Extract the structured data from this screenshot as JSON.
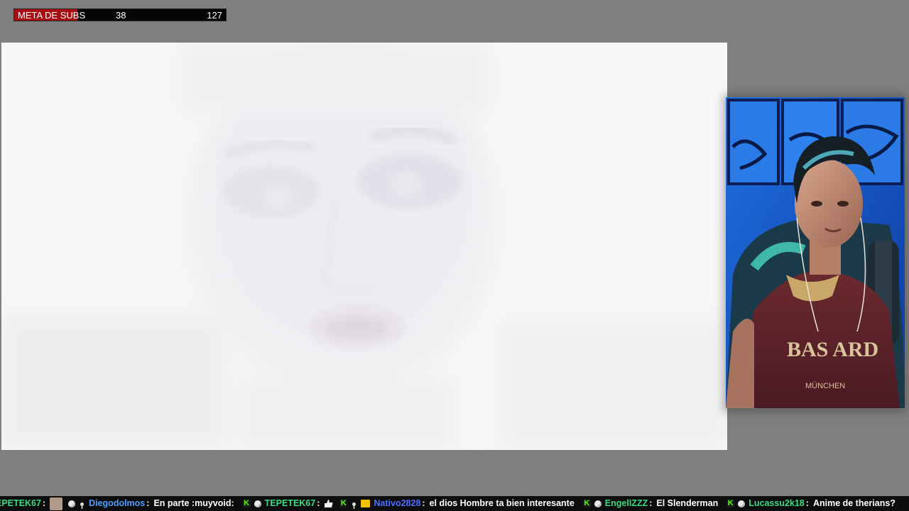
{
  "goal": {
    "label": "META DE SUBS",
    "current": "38",
    "target": "127",
    "current_value": 38,
    "target_value": 127,
    "fill_color": "#a80f14"
  },
  "video": {
    "subject": "faded close-up face (overexposed video frame)"
  },
  "webcam": {
    "shirt_text_top": "BAS ARD",
    "shirt_text_bottom": "MÜNCHEN"
  },
  "chat": {
    "messages": [
      {
        "user": "EPETEK67",
        "user_color": "#3ddc84",
        "badges": [
          "avatar-emote"
        ],
        "text": ""
      },
      {
        "user": "Diegodolmos",
        "user_color": "#4f9dff",
        "badges": [
          "kick-badge",
          "sub-badge",
          "mic-badge"
        ],
        "text": "En parte :muyvoid:"
      },
      {
        "user": "TEPETEK67",
        "user_color": "#3ddc84",
        "badges": [
          "kick-badge",
          "sub-badge"
        ],
        "text": ""
      },
      {
        "user": "Nativo2828",
        "user_color": "#4f6dff",
        "badges": [
          "kick-badge",
          "mic-badge",
          "crown-badge"
        ],
        "text": "el dios Hombre ta bien interesante"
      },
      {
        "user": "EngellZZZ",
        "user_color": "#3ddc84",
        "badges": [
          "kick-badge",
          "sub-badge"
        ],
        "text": "El Slenderman"
      },
      {
        "user": "Lucassu2k18",
        "user_color": "#3ddc84",
        "badges": [
          "kick-badge",
          "sub-badge"
        ],
        "text": "Anime de therians?"
      }
    ]
  }
}
